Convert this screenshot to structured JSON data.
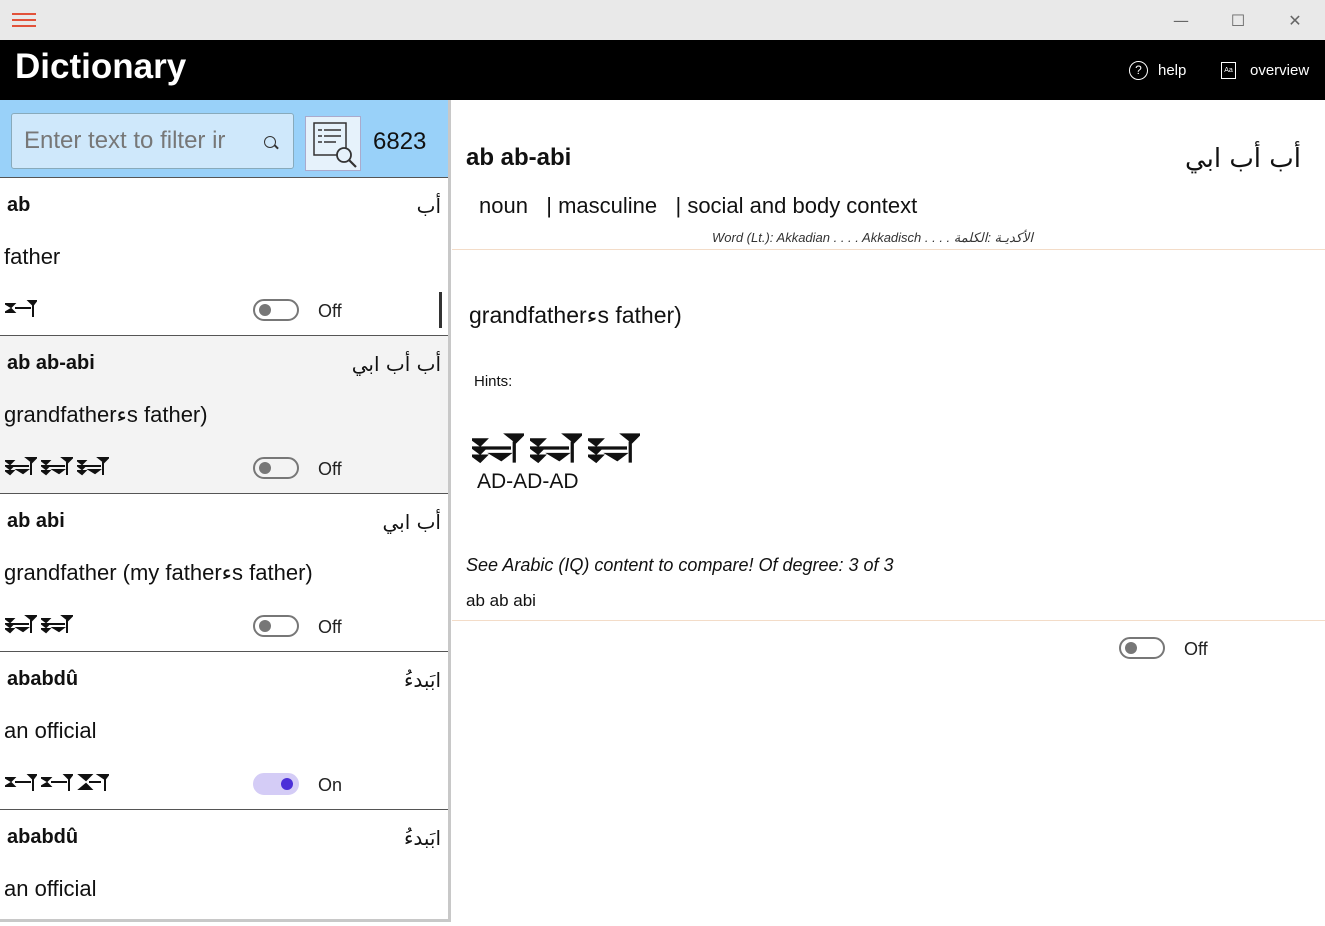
{
  "window": {
    "title_bar_icons": [
      "hamburger-icon",
      "minimize-icon",
      "maximize-icon",
      "close-icon"
    ]
  },
  "header": {
    "title": "Dictionary",
    "help_label": "help",
    "overview_label": "overview",
    "overview_icon_text": "Aa"
  },
  "search": {
    "placeholder": "Enter text to filter ir",
    "count": "6823"
  },
  "entries": [
    {
      "term": "ab",
      "arabic": "أب",
      "definition": "father",
      "cuneiform_count": 1,
      "toggle": "Off",
      "on": false
    },
    {
      "term": "ab ab-abi",
      "arabic": "أب أب ابي",
      "definition": "grandfatherءs father)",
      "cuneiform_count": 3,
      "toggle": "Off",
      "on": false
    },
    {
      "term": "ab abi",
      "arabic": "أب ابي",
      "definition": "grandfather (my fatherءs father)",
      "cuneiform_count": 2,
      "toggle": "Off",
      "on": false
    },
    {
      "term": "ababdû",
      "arabic": "ابَبدءُ",
      "definition": "an official",
      "cuneiform_count": 3,
      "toggle": "On",
      "on": true
    },
    {
      "term": "ababdû",
      "arabic": "ابَبدءُ",
      "definition": "an official",
      "cuneiform_count": 0,
      "toggle": "",
      "on": false
    }
  ],
  "detail": {
    "term": "ab ab-abi",
    "arabic": "أب أب ابي",
    "tags": "noun   | masculine   | social and body context",
    "word_line": "Word (Lt.):  Akkadian . . . . Akkadisch . . . . الأكديـة  :الكلمة",
    "definition": "grandfatherءs father)",
    "hints_label": "Hints:",
    "transliteration": "AD-AD-AD",
    "compare": "See Arabic (IQ) content to compare!  Of degree: 3 of 3",
    "small_term": "ab ab abi",
    "toggle": "Off"
  },
  "colors": {
    "accent": "#e2523a",
    "search_bg": "#99d1f9",
    "toggle_on": "#4b2fd8",
    "divider": "#f3dcc8"
  }
}
